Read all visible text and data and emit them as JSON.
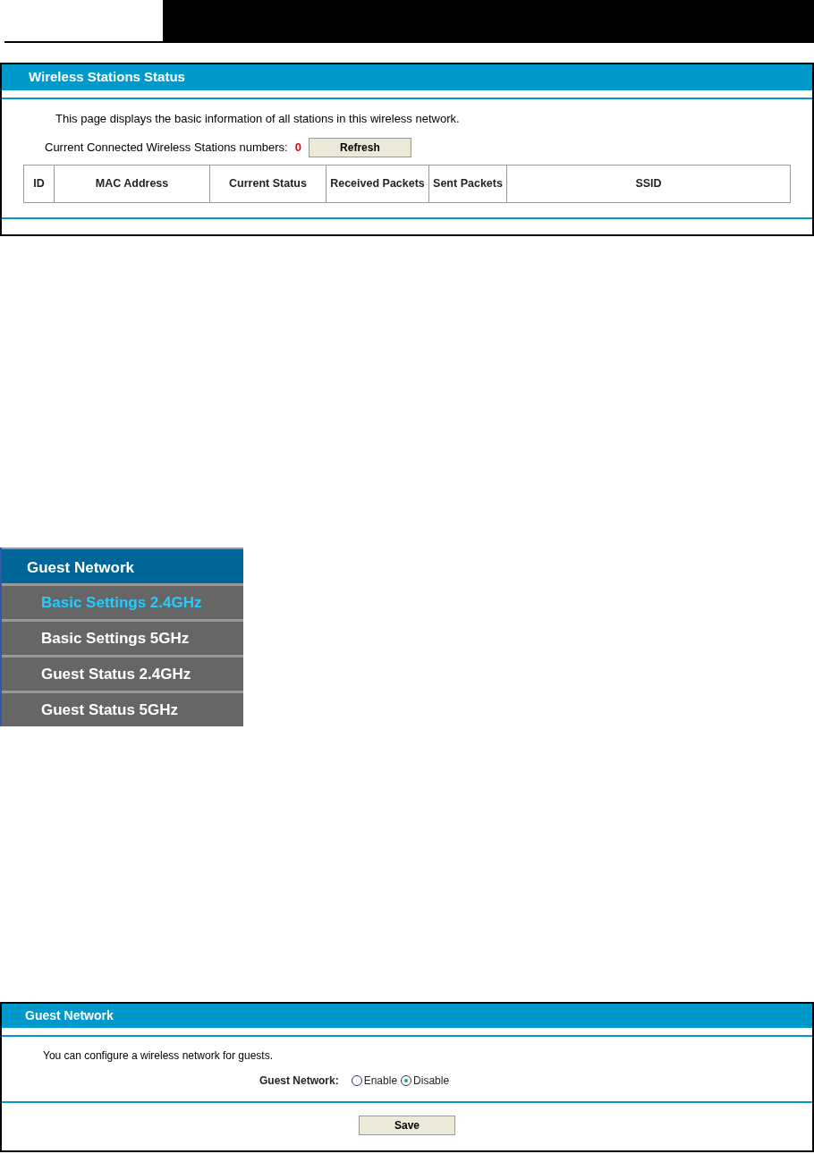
{
  "stations_panel": {
    "title": "Wireless Stations Status",
    "description": "This page displays the basic information of all stations in this wireless network.",
    "count_label": "Current Connected Wireless Stations numbers:",
    "count": "0",
    "refresh_button": "Refresh",
    "table": {
      "columns": [
        "ID",
        "MAC Address",
        "Current Status",
        "Received Packets",
        "Sent Packets",
        "SSID"
      ]
    }
  },
  "menu": {
    "title": "Guest Network",
    "items": [
      {
        "label": "Basic Settings 2.4GHz",
        "selected": true
      },
      {
        "label": "Basic Settings 5GHz",
        "selected": false
      },
      {
        "label": "Guest Status 2.4GHz",
        "selected": false
      },
      {
        "label": "Guest Status 5GHz",
        "selected": false
      }
    ]
  },
  "guest_panel": {
    "title": "Guest Network",
    "description": "You can configure a wireless network for guests.",
    "field_label": "Guest Network:",
    "options": [
      {
        "label": "Enable",
        "selected": false
      },
      {
        "label": "Disable",
        "selected": true
      }
    ],
    "save_button": "Save"
  }
}
